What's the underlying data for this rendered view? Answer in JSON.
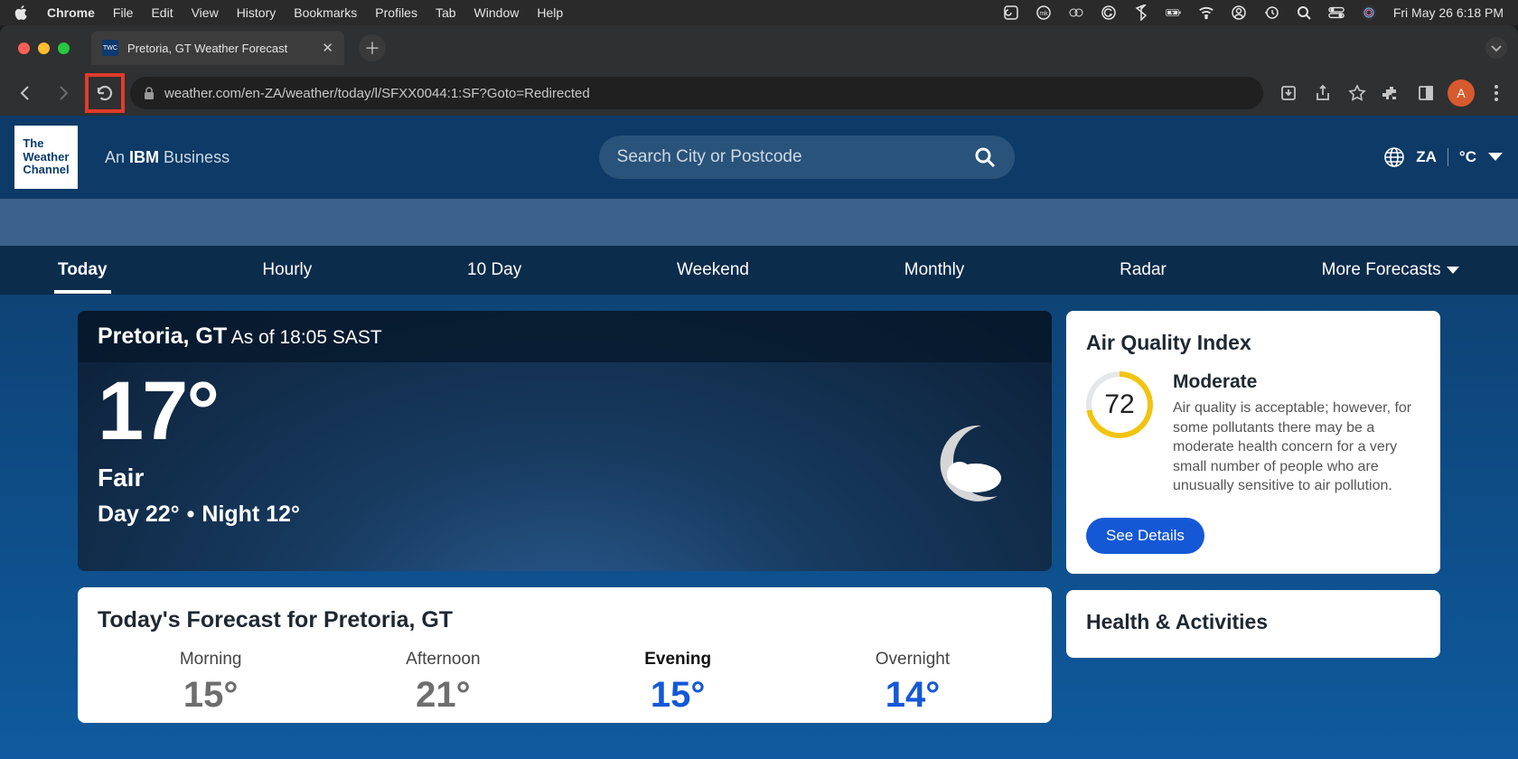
{
  "menubar": {
    "app": "Chrome",
    "items": [
      "File",
      "Edit",
      "View",
      "History",
      "Bookmarks",
      "Profiles",
      "Tab",
      "Window",
      "Help"
    ],
    "clock": "Fri May 26  6:18 PM"
  },
  "browser": {
    "tab_title": "Pretoria, GT Weather Forecast",
    "url": "weather.com/en-ZA/weather/today/l/SFXX0044:1:SF?Goto=Redirected",
    "avatar_initial": "A"
  },
  "site": {
    "logo_lines": "The\nWeather\nChannel",
    "tagline_prefix": "An ",
    "tagline_bold": "IBM",
    "tagline_suffix": " Business",
    "search_placeholder": "Search City or Postcode",
    "locale_code": "ZA",
    "unit": "°C"
  },
  "nav": {
    "items": [
      "Today",
      "Hourly",
      "10 Day",
      "Weekend",
      "Monthly",
      "Radar",
      "More Forecasts"
    ],
    "active_index": 0
  },
  "hero": {
    "location": "Pretoria, GT",
    "asof_prefix": "As of ",
    "asof_time": "18:05 SAST",
    "temp": "17°",
    "condition": "Fair",
    "day_label": "Day",
    "day_temp": "22°",
    "night_label": "Night",
    "night_temp": "12°"
  },
  "forecast": {
    "title": "Today's Forecast for Pretoria, GT",
    "periods": [
      {
        "name": "Morning",
        "temp": "15°"
      },
      {
        "name": "Afternoon",
        "temp": "21°"
      },
      {
        "name": "Evening",
        "temp": "15°"
      },
      {
        "name": "Overnight",
        "temp": "14°"
      }
    ],
    "current_index": 2
  },
  "aqi": {
    "title": "Air Quality Index",
    "value": "72",
    "level": "Moderate",
    "description": "Air quality is acceptable; however, for some pollutants there may be a moderate health concern for a very small number of people who are unusually sensitive to air pollution.",
    "button": "See Details"
  },
  "health": {
    "title": "Health & Activities"
  }
}
